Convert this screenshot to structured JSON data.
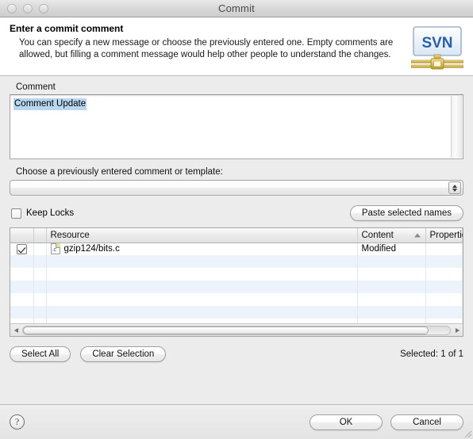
{
  "window": {
    "title": "Commit",
    "traffic_lights": [
      "close-button",
      "minimize-button",
      "zoom-button"
    ]
  },
  "banner": {
    "title": "Enter a commit comment",
    "description": "You can specify a new message or choose the previously entered one. Empty comments are allowed, but filling a comment message would help other people to understand the changes.",
    "logo_text": "SVN"
  },
  "comment": {
    "label": "Comment",
    "value": "Comment Update",
    "selected": true
  },
  "template": {
    "label": "Choose a previously entered comment or template:",
    "value": "",
    "options": []
  },
  "options_row": {
    "keep_locks_label": "Keep Locks",
    "keep_locks_checked": false,
    "paste_button": "Paste selected names"
  },
  "table": {
    "columns": [
      "",
      "",
      "Resource",
      "Content",
      "Properties"
    ],
    "sort_column": "Content",
    "sort_direction": "ascending",
    "rows": [
      {
        "checked": true,
        "icon": "c-file-icon",
        "resource": "gzip124/bits.c",
        "content": "Modified",
        "properties": ""
      }
    ],
    "empty_rows": 7
  },
  "selection": {
    "select_all_button": "Select All",
    "clear_selection_button": "Clear Selection",
    "status": "Selected: 1 of 1"
  },
  "footer": {
    "help_label": "?",
    "ok_button": "OK",
    "cancel_button": "Cancel"
  },
  "colors": {
    "window_bg": "#ececec",
    "banner_bg": "#ffffff",
    "selection_highlight": "#b8d6f0",
    "row_stripe": "#edf3fa",
    "logo_blue": "#2b5fa8",
    "logo_gold": "#c9a83c"
  }
}
